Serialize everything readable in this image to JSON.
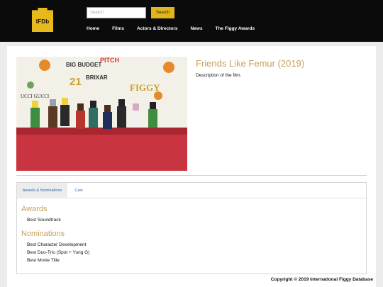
{
  "header": {
    "logo_text": "IFDb",
    "search_placeholder": "Search",
    "search_button": "Search",
    "nav": [
      "Home",
      "Films",
      "Actors & Directors",
      "News",
      "The Figgy Awards"
    ]
  },
  "movie": {
    "title": "Friends Like Femur (2019)",
    "description": "Description of the film.",
    "photo_backdrop_words": [
      "BIG BUDGET",
      "PITCH",
      "BRIXAR",
      "FIGGY",
      "UCCI GUCCI",
      "21"
    ]
  },
  "tabs": [
    "Awards & Nominations",
    "Cast"
  ],
  "awards": {
    "heading": "Awards",
    "items": [
      "Best Soundtrack"
    ]
  },
  "nominations": {
    "heading": "Nominations",
    "items": [
      "Best Character Development",
      "Best Duo-Trio (Spot + Yung G)",
      "Best Movie Title"
    ]
  },
  "footer": "Copyright © 2019 International Figgy Database",
  "colors": {
    "accent": "#e3b51b",
    "title_gold": "#c6a15b",
    "link_blue": "#2a6db5",
    "header_bg": "#0b0b0b"
  }
}
